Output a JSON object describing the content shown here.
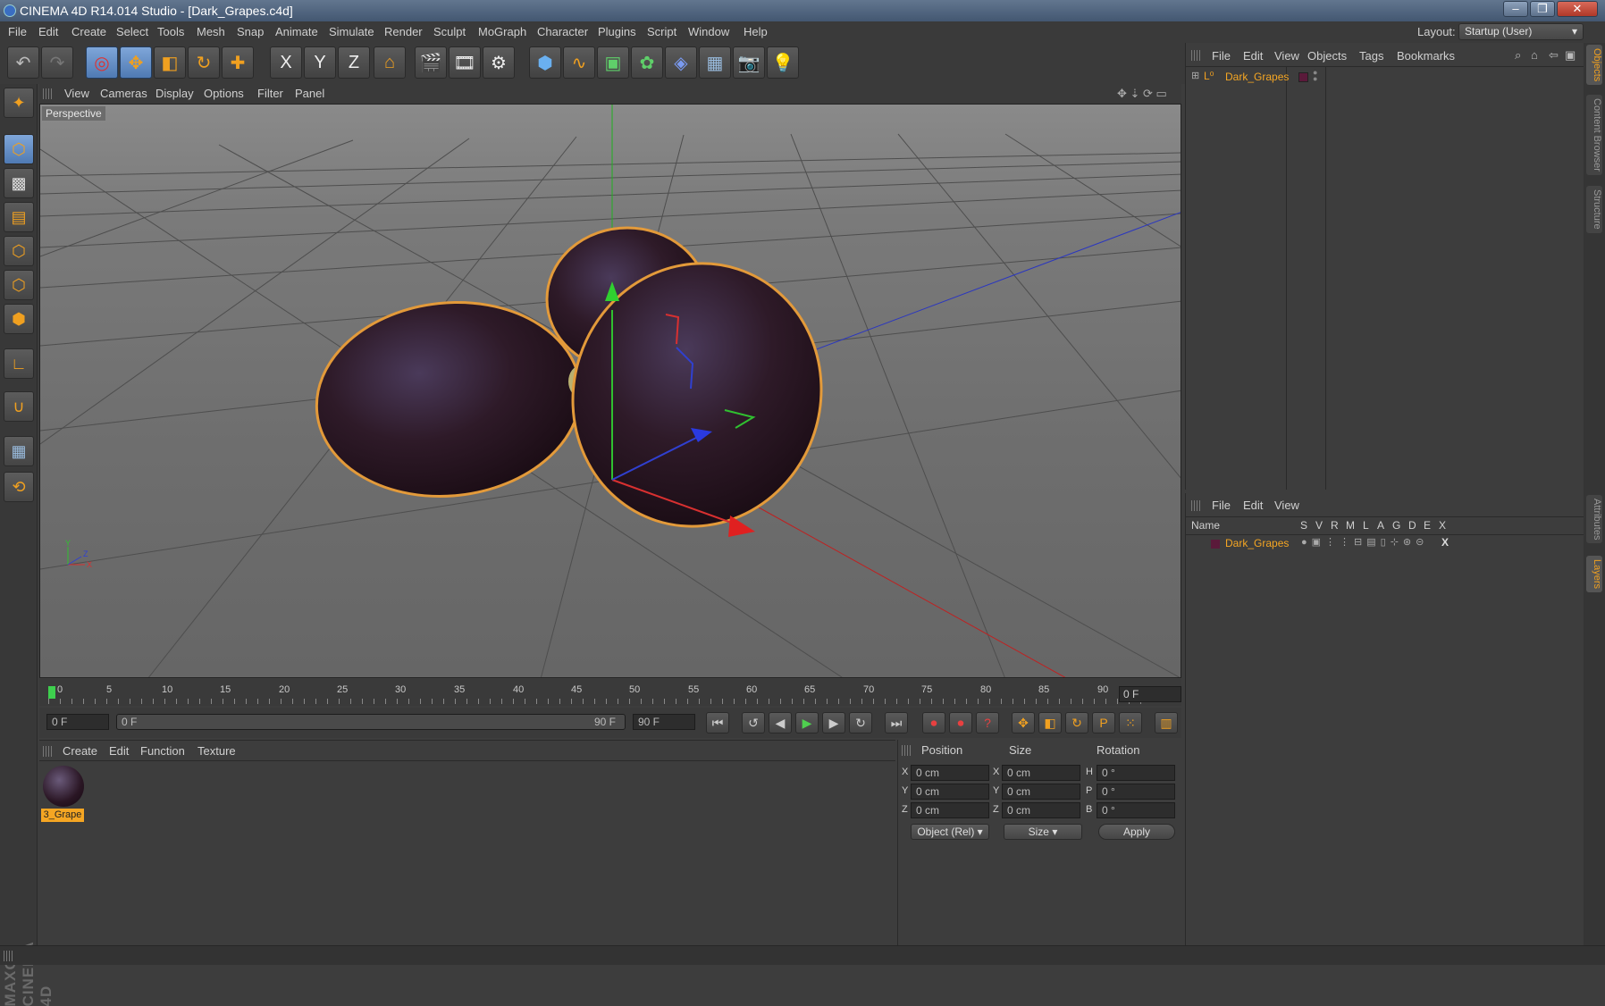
{
  "window": {
    "title": "CINEMA 4D R14.014 Studio - [Dark_Grapes.c4d]",
    "controls": [
      "–",
      "❐",
      "✕"
    ]
  },
  "menu": [
    "File",
    "Edit",
    "Create",
    "Select",
    "Tools",
    "Mesh",
    "Snap",
    "Animate",
    "Simulate",
    "Render",
    "Sculpt",
    "MoGraph",
    "Character",
    "Plugins",
    "Script",
    "Window",
    "Help"
  ],
  "layout": {
    "label": "Layout:",
    "value": "Startup (User)"
  },
  "toolbar": {
    "axis_x": "X",
    "axis_y": "Y",
    "axis_z": "Z",
    "icons": [
      "undo-icon",
      "redo-icon",
      "select-icon",
      "move-icon",
      "scale-icon",
      "rotate-icon",
      "add-icon",
      "lock-x-icon",
      "lock-y-icon",
      "lock-z-icon",
      "coord-system-icon",
      "render-view-icon",
      "render-picture-queue-icon",
      "render-settings-icon",
      "cube-icon",
      "spline-icon",
      "nurbs-icon",
      "array-icon",
      "deformer-icon",
      "floor-icon",
      "camera-icon",
      "light-icon"
    ]
  },
  "viewport": {
    "menu": [
      "View",
      "Cameras",
      "Display",
      "Options",
      "Filter",
      "Panel"
    ],
    "label": "Perspective",
    "axis_y": "Y",
    "axis_x": "X",
    "axis_z": "Z"
  },
  "timeline": {
    "ticks": [
      "0",
      "5",
      "10",
      "15",
      "20",
      "25",
      "30",
      "35",
      "40",
      "45",
      "50",
      "55",
      "60",
      "65",
      "70",
      "75",
      "80",
      "85",
      "90"
    ],
    "current_frame": "0 F"
  },
  "transport": {
    "start": "0 F",
    "range_start": "0 F",
    "range_end": "90 F",
    "end": "90 F"
  },
  "materials": {
    "menu": [
      "Create",
      "Edit",
      "Function",
      "Texture"
    ],
    "items": [
      {
        "name": "3_Grape"
      }
    ]
  },
  "coordinates": {
    "headers": [
      "Position",
      "Size",
      "Rotation"
    ],
    "rows": [
      {
        "axis": "X",
        "pos": "0 cm",
        "size_axis": "X",
        "size": "0 cm",
        "rot_axis": "H",
        "rot": "0 °"
      },
      {
        "axis": "Y",
        "pos": "0 cm",
        "size_axis": "Y",
        "size": "0 cm",
        "rot_axis": "P",
        "rot": "0 °"
      },
      {
        "axis": "Z",
        "pos": "0 cm",
        "size_axis": "Z",
        "size": "0 cm",
        "rot_axis": "B",
        "rot": "0 °"
      }
    ],
    "mode": "Object (Rel)",
    "size_mode": "Size",
    "apply": "Apply"
  },
  "objects": {
    "menu": [
      "File",
      "Edit",
      "View",
      "Objects",
      "Tags",
      "Bookmarks"
    ],
    "items": [
      {
        "name": "Dark_Grapes",
        "color": "#5a1a3a"
      }
    ]
  },
  "layers": {
    "menu": [
      "File",
      "Edit",
      "View"
    ],
    "columns": [
      "Name",
      "S",
      "V",
      "R",
      "M",
      "L",
      "A",
      "G",
      "D",
      "E",
      "X"
    ],
    "items": [
      {
        "name": "Dark_Grapes",
        "flag_x": "X"
      }
    ]
  },
  "right_tabs": [
    "Objects",
    "Content Browser",
    "Structure",
    "Attributes",
    "Layers"
  ],
  "branding": "MAXON CINEMA 4D",
  "colors": {
    "accent": "#f0a020",
    "selected_text": "#f5a623",
    "x_axis": "#d83030",
    "y_axis": "#30c030",
    "z_axis": "#3040d0"
  }
}
